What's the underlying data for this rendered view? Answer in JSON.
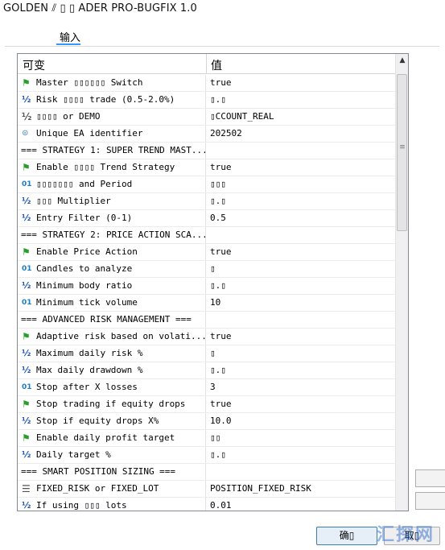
{
  "window": {
    "title": "GOLDEN ⫽ ▯ ▯ ADER PRO-BUGFIX 1.0"
  },
  "tabs": [
    {
      "label": "输入"
    }
  ],
  "grid": {
    "headers": {
      "variable": "可变",
      "value": "值"
    },
    "rows": [
      {
        "type": "bool",
        "icon": "bool-icon",
        "name": "Master ▯▯▯▯▯▯ Switch",
        "value": "true"
      },
      {
        "type": "double",
        "icon": "double-icon",
        "name": "Risk ▯▯▯▯ trade (0.5-2.0%)",
        "value": "▯.▯"
      },
      {
        "type": "enum",
        "icon": "enum-icon",
        "name": "▯▯▯▯ or DEMO",
        "value": "▯CCOUNT_REAL"
      },
      {
        "type": "string",
        "icon": "string-icon",
        "name": "Unique EA identifier",
        "value": "202502"
      },
      {
        "type": "section",
        "name": "=== STRATEGY 1: SUPER TREND MAST...",
        "value": ""
      },
      {
        "type": "bool",
        "icon": "bool-icon",
        "name": "Enable ▯▯▯▯ Trend Strategy",
        "value": "true"
      },
      {
        "type": "int",
        "icon": "int-icon",
        "name": "▯▯▯▯▯▯▯ and Period",
        "value": "▯▯▯"
      },
      {
        "type": "double",
        "icon": "double-icon",
        "name": "▯▯▯ Multiplier",
        "value": "▯.▯"
      },
      {
        "type": "double",
        "icon": "double-icon",
        "name": "Entry Filter (0-1)",
        "value": "0.5"
      },
      {
        "type": "section",
        "name": "=== STRATEGY 2: PRICE ACTION SCA...",
        "value": ""
      },
      {
        "type": "bool",
        "icon": "bool-icon",
        "name": "Enable Price Action",
        "value": "true"
      },
      {
        "type": "int",
        "icon": "int-icon",
        "name": "Candles to analyze",
        "value": "▯"
      },
      {
        "type": "double",
        "icon": "double-icon",
        "name": "Minimum body ratio",
        "value": "▯.▯"
      },
      {
        "type": "int",
        "icon": "int-icon",
        "name": "Minimum tick volume",
        "value": "10"
      },
      {
        "type": "section",
        "name": "=== ADVANCED RISK MANAGEMENT ===",
        "value": ""
      },
      {
        "type": "bool",
        "icon": "bool-icon",
        "name": "Adaptive risk based on volati...",
        "value": "true"
      },
      {
        "type": "double",
        "icon": "double-icon",
        "name": "Maximum daily risk %",
        "value": "▯"
      },
      {
        "type": "double",
        "icon": "double-icon",
        "name": "Max daily drawdown %",
        "value": "▯.▯"
      },
      {
        "type": "int",
        "icon": "int-icon",
        "name": "Stop after X losses",
        "value": "3"
      },
      {
        "type": "bool",
        "icon": "bool-icon",
        "name": "Stop trading if equity drops",
        "value": "true"
      },
      {
        "type": "double",
        "icon": "double-icon",
        "name": "Stop if equity drops X%",
        "value": "10.0"
      },
      {
        "type": "bool",
        "icon": "bool-icon",
        "name": "Enable daily profit target",
        "value": "▯▯"
      },
      {
        "type": "double",
        "icon": "double-icon",
        "name": "Daily target %",
        "value": "▯.▯"
      },
      {
        "type": "section",
        "name": "=== SMART POSITION SIZING ===",
        "value": ""
      },
      {
        "type": "enum",
        "icon": "list-icon",
        "name": "FIXED_RISK or FIXED_LOT",
        "value": "POSITION_FIXED_RISK"
      },
      {
        "type": "double",
        "icon": "double-icon",
        "name": "If using ▯▯▯ lots",
        "value": "0.01"
      }
    ]
  },
  "buttons": {
    "ok": "确▯",
    "cancel": "取▯"
  },
  "watermark": "汇探网",
  "icon_glyphs": {
    "bool": "⚑",
    "double": "½",
    "int": "01",
    "string": "⊙",
    "enum": "½",
    "list": "☰"
  }
}
